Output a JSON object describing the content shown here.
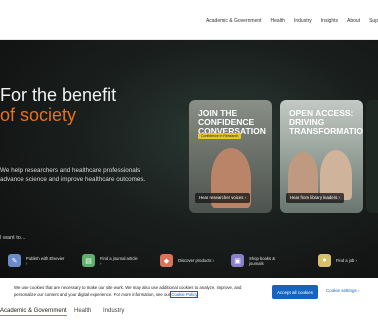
{
  "nav": {
    "items": [
      "Academic & Government",
      "Health",
      "Industry",
      "Insights",
      "About",
      "Sup"
    ]
  },
  "hero": {
    "title_line1": "For the benefit",
    "title_line2": "of society",
    "subtitle": "We help researchers and healthcare professionals advance science and improve healthcare outcomes."
  },
  "cards": [
    {
      "title": "JOIN THE CONFIDENCE CONVERSATION",
      "chip": "Confidence in Research",
      "button": "Hear researcher voices ›"
    },
    {
      "title": "OPEN ACCESS: DRIVING TRANSFORMATION",
      "button": "Hear from library leaders ›"
    }
  ],
  "quick_links": {
    "label": "I want to...",
    "items": [
      {
        "label": "Publish with Elsevier ›",
        "icon": "publish-icon",
        "color": "#6b8cc9"
      },
      {
        "label": "Find a journal article ›",
        "icon": "journal-icon",
        "color": "#5fae6b"
      },
      {
        "label": "Discover products ›",
        "icon": "products-icon",
        "color": "#d9735a"
      },
      {
        "label": "Shop books & journals",
        "icon": "shop-icon",
        "color": "#8a7fc9"
      },
      {
        "label": "Find a job ›",
        "icon": "job-icon",
        "color": "#d9c06a"
      }
    ]
  },
  "cookie": {
    "text": "We use cookies that are necessary to make our site work. We may also use additional cookies to analyze, improve, and personalize our content and your digital experience. For more information, see our",
    "link": "Cookie Policy",
    "accept": "Accept all cookies",
    "settings": "Cookie settings ›"
  },
  "tabs": [
    "Academic & Government",
    "Health",
    "Industry"
  ],
  "colors": {
    "accent": "#e9711c",
    "primary_button": "#1565c0"
  }
}
